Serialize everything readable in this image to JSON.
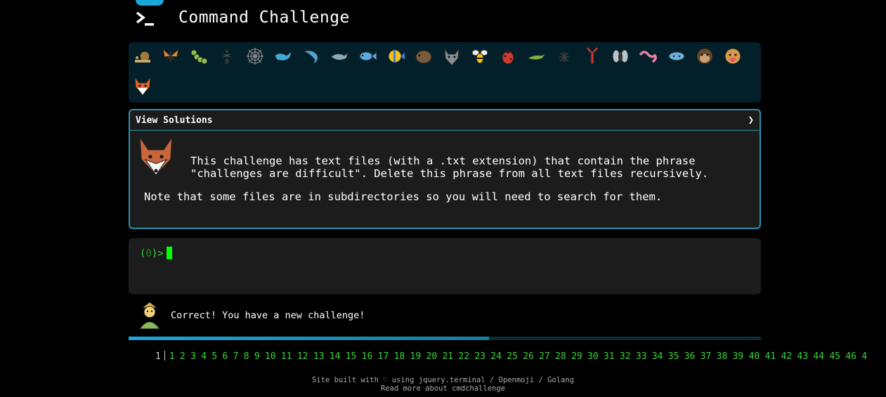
{
  "header": {
    "title": "Command Challenge",
    "logo_icon": "terminal-prompt-icon"
  },
  "badges": [
    "snail",
    "butterfly",
    "caterpillar",
    "ant",
    "spider-web",
    "whale",
    "dolphin-swimming",
    "dolphin",
    "fish",
    "tropical-fish",
    "hedgehog",
    "wolf",
    "bee",
    "ladybug",
    "lizard",
    "spider",
    "lobster",
    "fly",
    "worm",
    "microbe",
    "monkey",
    "dog",
    "fox"
  ],
  "panel": {
    "header": "View Solutions",
    "chevron": "❯",
    "description_line1": "This challenge has text files (with a .txt extension) that contain the phrase",
    "description_line2": "\"challenges are difficult\". Delete this phrase from all text files recursively.",
    "note": "Note that some files are in subdirectories so you will need to search for them."
  },
  "terminal": {
    "prompt_open": "(",
    "prompt_count": "0",
    "prompt_close": ")>"
  },
  "status": {
    "message": "Correct! You have a new challenge!",
    "progress_fraction": 0.57
  },
  "levels": {
    "current": "1",
    "items": [
      "1",
      "2",
      "3",
      "4",
      "5",
      "6",
      "7",
      "8",
      "9",
      "10",
      "11",
      "12",
      "13",
      "14",
      "15",
      "16",
      "17",
      "18",
      "19",
      "20",
      "21",
      "22",
      "23",
      "24",
      "25",
      "26",
      "27",
      "28",
      "29",
      "30",
      "31",
      "32",
      "33",
      "34",
      "35",
      "36",
      "37",
      "38",
      "39",
      "40",
      "41",
      "42",
      "43",
      "44",
      "45",
      "46",
      "4"
    ]
  },
  "footer": {
    "line1_prefix": "Site built with",
    "heart": "♡",
    "line1_using": "using",
    "jquery_link": "jquery.terminal",
    "sep1": "/",
    "openmoji_link": "Openmoji",
    "sep2": "/",
    "golang_link": "Golang",
    "line2": "Read more about cmdchallenge"
  }
}
